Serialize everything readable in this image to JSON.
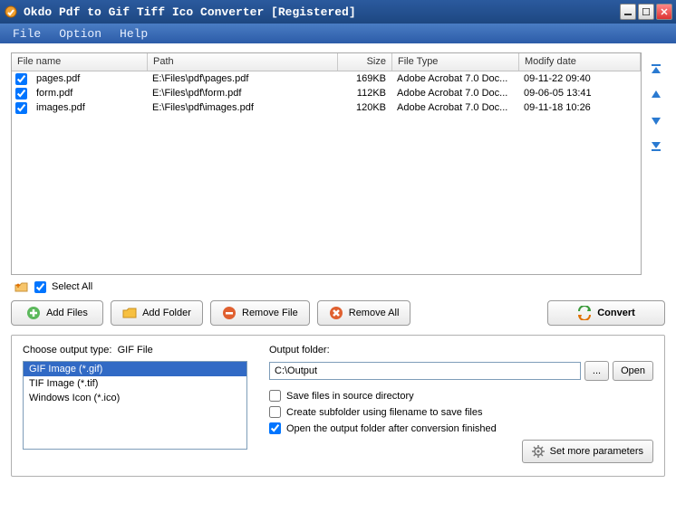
{
  "window": {
    "title": "Okdo Pdf to Gif  Tiff  Ico Converter [Registered]"
  },
  "menu": {
    "file": "File",
    "option": "Option",
    "help": "Help"
  },
  "table": {
    "headers": {
      "name": "File name",
      "path": "Path",
      "size": "Size",
      "type": "File Type",
      "date": "Modify date"
    },
    "rows": [
      {
        "checked": true,
        "name": "pages.pdf",
        "path": "E:\\Files\\pdf\\pages.pdf",
        "size": "169KB",
        "type": "Adobe Acrobat 7.0 Doc...",
        "date": "09-11-22 09:40"
      },
      {
        "checked": true,
        "name": "form.pdf",
        "path": "E:\\Files\\pdf\\form.pdf",
        "size": "112KB",
        "type": "Adobe Acrobat 7.0 Doc...",
        "date": "09-06-05 13:41"
      },
      {
        "checked": true,
        "name": "images.pdf",
        "path": "E:\\Files\\pdf\\images.pdf",
        "size": "120KB",
        "type": "Adobe Acrobat 7.0 Doc...",
        "date": "09-11-18 10:26"
      }
    ]
  },
  "selectall": {
    "label": "Select All",
    "checked": true
  },
  "buttons": {
    "add_files": "Add Files",
    "add_folder": "Add Folder",
    "remove_file": "Remove File",
    "remove_all": "Remove All",
    "convert": "Convert",
    "browse": "...",
    "open": "Open",
    "more": "Set more parameters"
  },
  "output_type": {
    "label_prefix": "Choose output type:",
    "current": "GIF File",
    "items": [
      {
        "label": "GIF Image (*.gif)",
        "selected": true
      },
      {
        "label": "TIF Image (*.tif)",
        "selected": false
      },
      {
        "label": "Windows Icon (*.ico)",
        "selected": false
      }
    ]
  },
  "output": {
    "label": "Output folder:",
    "value": "C:\\Output",
    "save_source": {
      "label": "Save files in source directory",
      "checked": false
    },
    "create_subfolder": {
      "label": "Create subfolder using filename to save files",
      "checked": false
    },
    "open_after": {
      "label": "Open the output folder after conversion finished",
      "checked": true
    }
  }
}
